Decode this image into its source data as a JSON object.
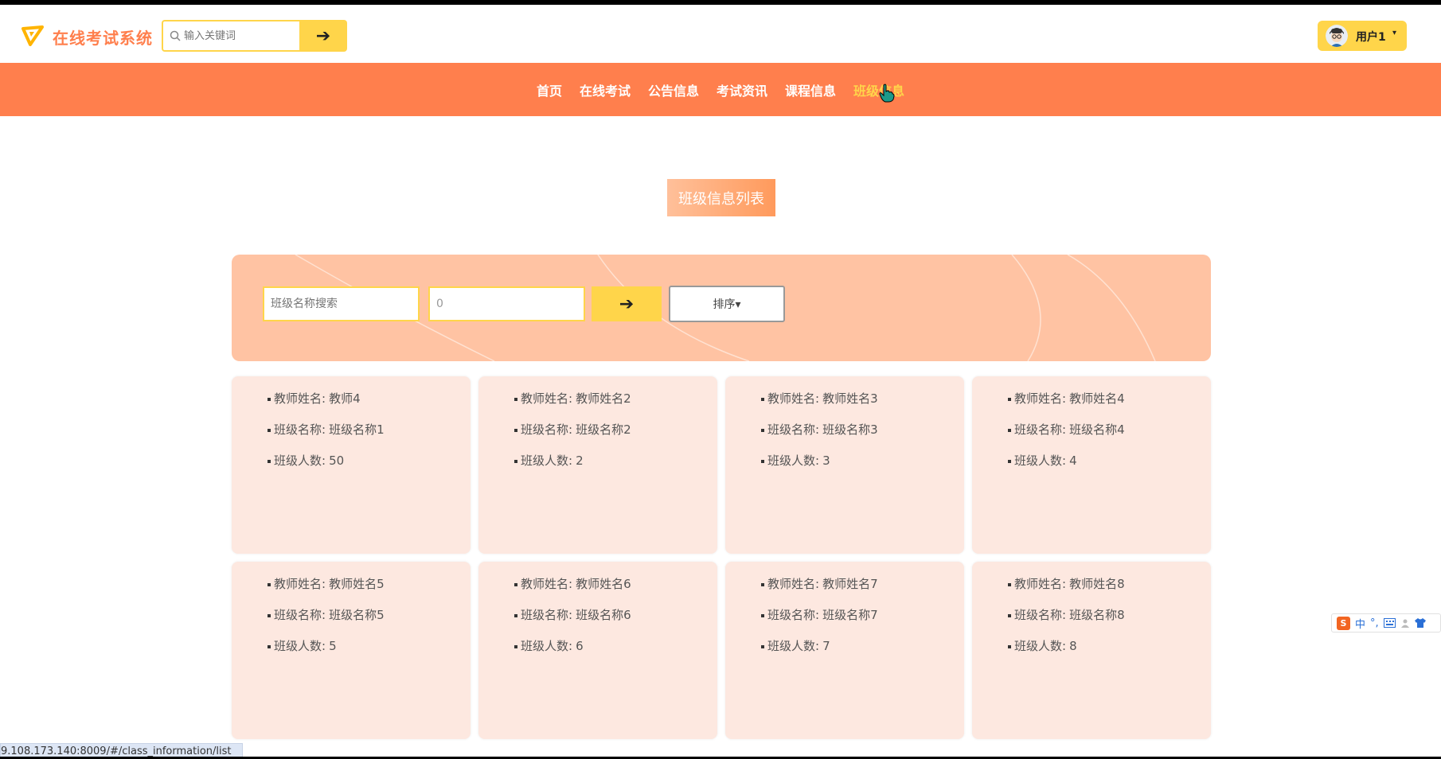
{
  "app": {
    "title": "在线考试系统",
    "search_placeholder": "输入关键词",
    "search_button": "➔",
    "user_name": "用户1",
    "user_caret": "▾"
  },
  "nav": {
    "items": [
      {
        "label": "首页",
        "active": false
      },
      {
        "label": "在线考试",
        "active": false
      },
      {
        "label": "公告信息",
        "active": false
      },
      {
        "label": "考试资讯",
        "active": false
      },
      {
        "label": "课程信息",
        "active": false
      },
      {
        "label": "班级信息",
        "active": true
      }
    ]
  },
  "page": {
    "title": "班级信息列表"
  },
  "filter": {
    "name_placeholder": "班级名称搜索",
    "count_value": "0",
    "search_button": "➔",
    "sort_label": "排序▾"
  },
  "labels": {
    "teacher": "教师姓名:",
    "class_name": "班级名称:",
    "count": "班级人数:"
  },
  "cards": [
    {
      "teacher": "教师4",
      "class_name": "班级名称1",
      "count": "50"
    },
    {
      "teacher": "教师姓名2",
      "class_name": "班级名称2",
      "count": "2"
    },
    {
      "teacher": "教师姓名3",
      "class_name": "班级名称3",
      "count": "3"
    },
    {
      "teacher": "教师姓名4",
      "class_name": "班级名称4",
      "count": "4"
    },
    {
      "teacher": "教师姓名5",
      "class_name": "班级名称5",
      "count": "5"
    },
    {
      "teacher": "教师姓名6",
      "class_name": "班级名称6",
      "count": "6"
    },
    {
      "teacher": "教师姓名7",
      "class_name": "班级名称7",
      "count": "7"
    },
    {
      "teacher": "教师姓名8",
      "class_name": "班级名称8",
      "count": "8"
    }
  ],
  "status_bar": {
    "url": "9.108.173.140:8009/#/class_information/list"
  },
  "ime": {
    "logo": "S",
    "lang": "中",
    "punct": "°,"
  },
  "colors": {
    "brand": "#ff7f4d",
    "accent": "#ffd54a",
    "card_bg": "#fde8e0",
    "panel_bg": "#ffc3a3"
  }
}
